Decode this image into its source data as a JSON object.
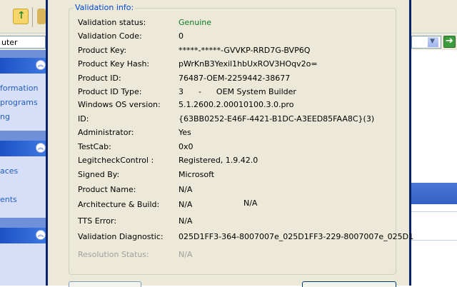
{
  "background_window": {
    "address_text": "uter",
    "sidebar": {
      "links": [
        "formation",
        " programs",
        "ng",
        "aces",
        "ents"
      ]
    }
  },
  "dialog": {
    "group_title": "Validation info:",
    "rows": [
      {
        "label": "Validation status:",
        "value": "Genuine"
      },
      {
        "label": "Validation Code:",
        "value": "0"
      },
      {
        "label": "Product Key:",
        "value": "*****-*****-GVVKP-RRD7G-BVP6Q"
      },
      {
        "label": "Product Key Hash:",
        "value": "pWrKnB3Yexil1hbUxROV3HOqv2o="
      },
      {
        "label": "Product ID:",
        "value": "76487-OEM-2259442-38677"
      },
      {
        "label": "Product ID Type:",
        "value": "3      -      OEM System Builder"
      },
      {
        "label": "Windows OS version:",
        "value": "5.1.2600.2.00010100.3.0.pro"
      },
      {
        "label": "ID:",
        "value": "{63BB0252-E46F-4421-B1DC-A3EED85FAA8C}(3)"
      },
      {
        "label": "Administrator:",
        "value": "Yes"
      },
      {
        "label": "TestCab:",
        "value": "0x0"
      },
      {
        "label": "LegitcheckControl :",
        "value": "Registered, 1.9.42.0"
      },
      {
        "label": "Signed By:",
        "value": "Microsoft"
      },
      {
        "label": "Product Name:",
        "value": "N/A"
      },
      {
        "label": "Architecture & Build:",
        "value": "N/A",
        "value2": "N/A"
      },
      {
        "label": "TTS Error:",
        "value": "N/A"
      },
      {
        "label": "Validation Diagnostic:",
        "value": "025D1FF3-364-8007007e_025D1FF3-229-8007007e_025D1"
      },
      {
        "label": "Resolution Status:",
        "value": "N/A"
      }
    ]
  },
  "colors": {
    "group_title": "#0046d5",
    "genuine": "#0a7a2a",
    "disabled_text": "#a0a0a0",
    "dialog_bg": "#ece9d8",
    "sidebar_header": "#1d52c5"
  }
}
